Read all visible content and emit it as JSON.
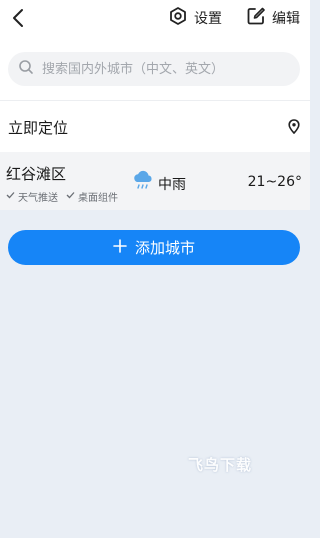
{
  "header": {
    "settings_label": "设置",
    "edit_label": "编辑"
  },
  "search": {
    "placeholder": "搜索国内外城市（中文、英文）"
  },
  "locate": {
    "label": "立即定位"
  },
  "city": {
    "name": "红谷滩区",
    "tags": [
      "天气推送",
      "桌面组件"
    ],
    "weather": "中雨",
    "temp_range": "21~26°"
  },
  "add_city": {
    "label": "添加城市"
  },
  "watermark": "飞鸟下载",
  "colors": {
    "accent": "#1685f7",
    "background": "#e9eef5",
    "rain_icon": "#5aa7e8"
  },
  "icons": {
    "back": "chevron-left-icon",
    "settings": "hexagon-gear-icon",
    "edit": "edit-icon",
    "search": "search-icon",
    "locate": "location-pin-icon",
    "weather": "rain-cloud-icon",
    "tag_check": "check-icon",
    "add": "plus-icon"
  }
}
